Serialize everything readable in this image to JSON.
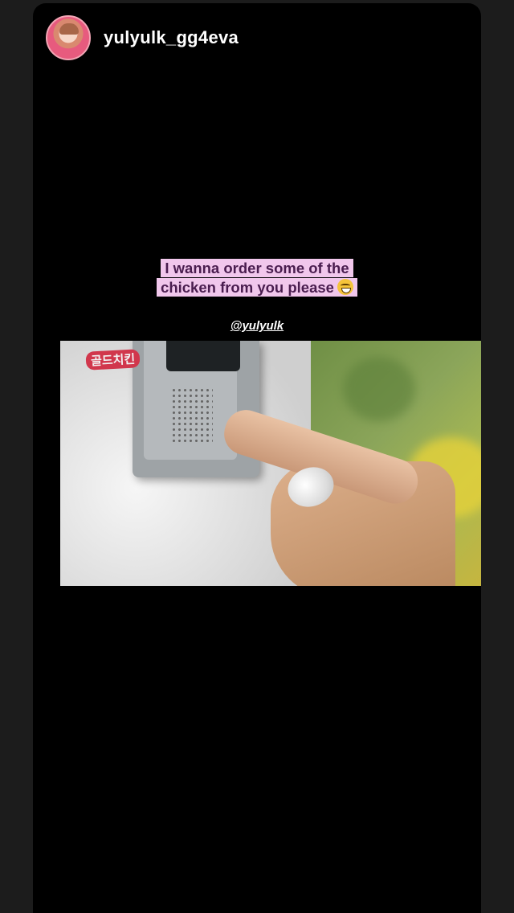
{
  "story": {
    "username": "yulyulk_gg4eva",
    "caption_line1": "I wanna order some of the",
    "caption_line2": "chicken from you please",
    "caption_emoji": "grinning-sweat-emoji",
    "mention": "@yulyulk"
  },
  "video": {
    "logo_text": "골드치킨"
  },
  "colors": {
    "background": "#000000",
    "caption_highlight": "#f1c7ec",
    "caption_text": "#4a1d4f"
  }
}
